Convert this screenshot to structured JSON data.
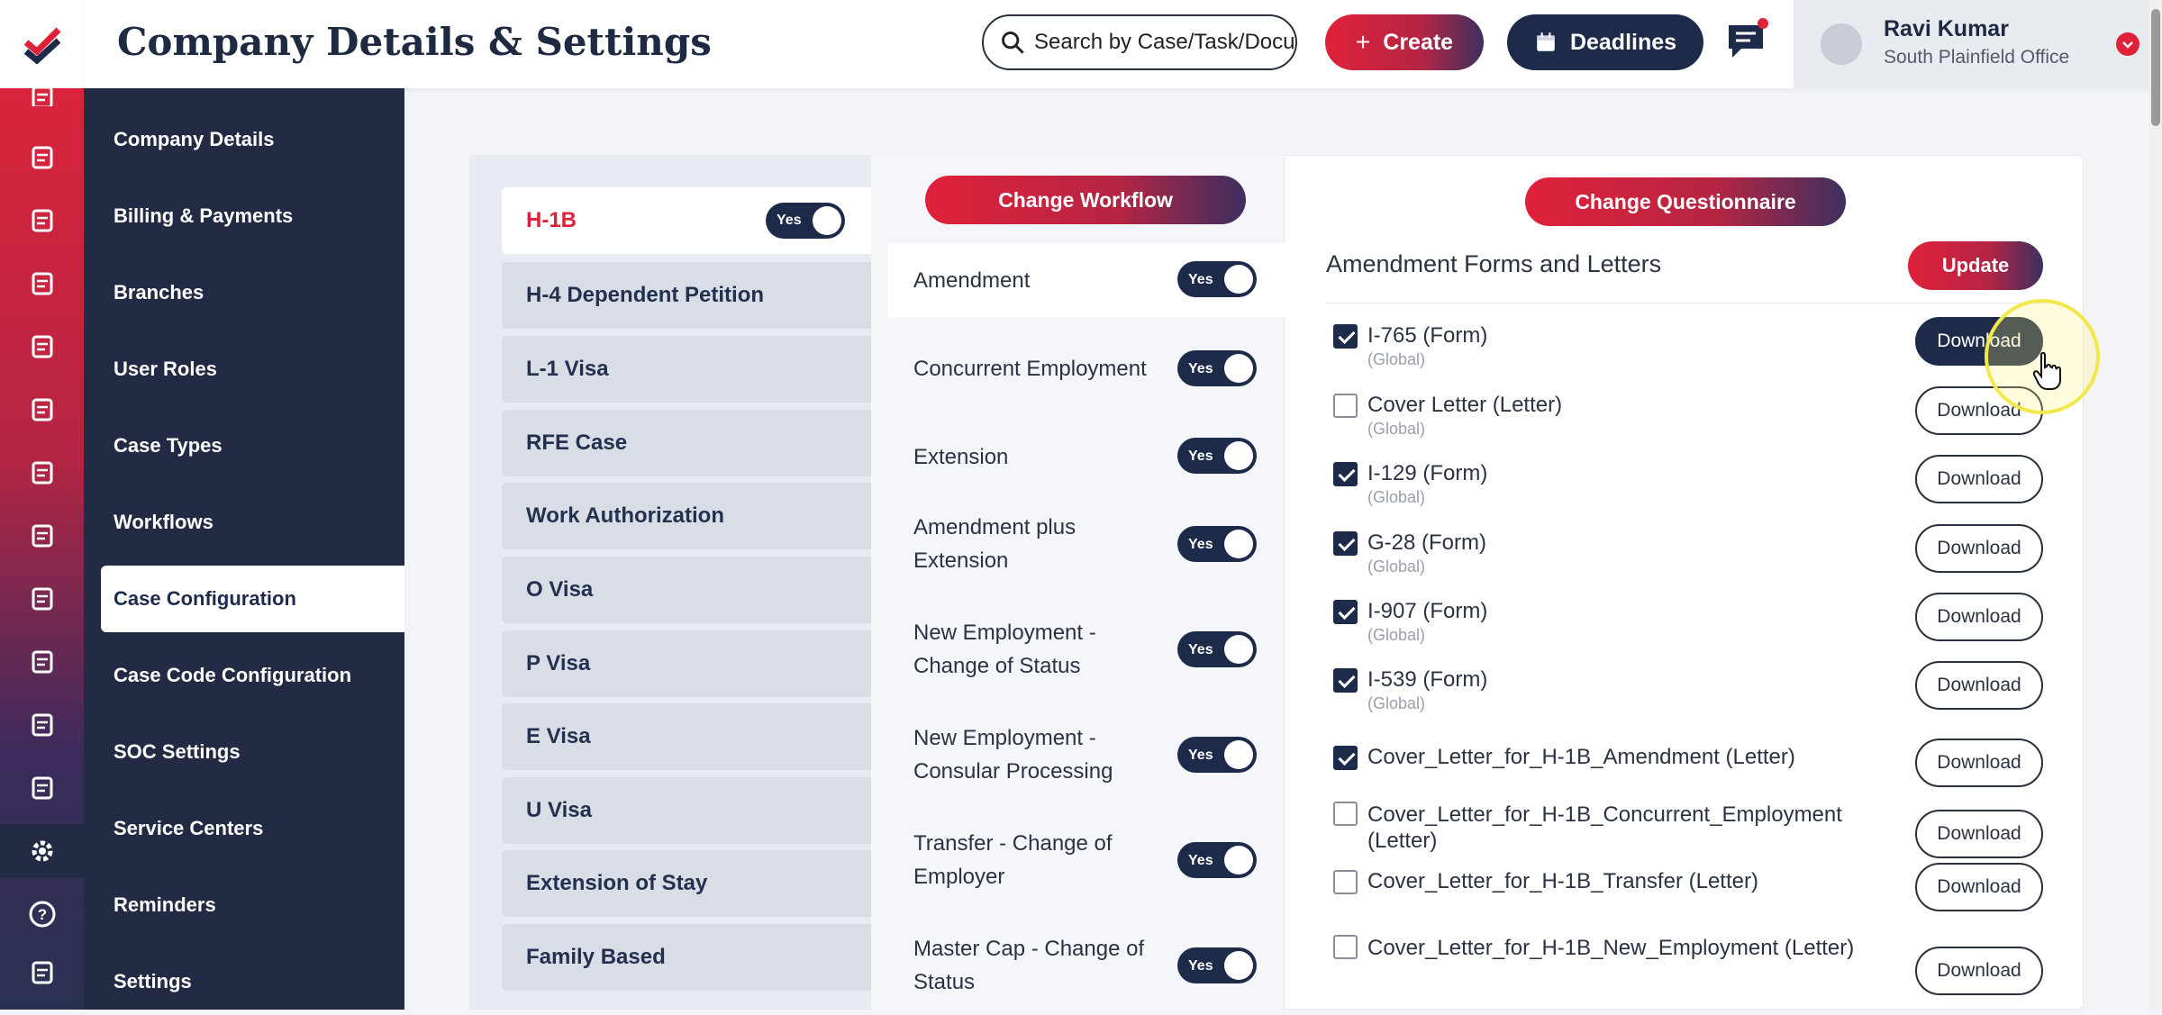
{
  "header": {
    "title": "Company Details & Settings",
    "search_placeholder": "Search by Case/Task/Document",
    "create_label": "Create",
    "deadlines_label": "Deadlines",
    "user_name": "Ravi Kumar",
    "user_office": "South Plainfield Office"
  },
  "rail_icons": [
    "edit-icon",
    "document-check-icon",
    "clipboard-icon",
    "user-icon",
    "person-icon",
    "folder-icon",
    "note-icon",
    "contact-icon",
    "book-icon",
    "team-icon",
    "file-edit-icon",
    "calendar-icon",
    "gear-icon",
    "help-icon",
    "profile-card-icon"
  ],
  "sidebar": {
    "items": [
      {
        "label": "Company Details"
      },
      {
        "label": "Billing & Payments"
      },
      {
        "label": "Branches"
      },
      {
        "label": "User Roles"
      },
      {
        "label": "Case Types"
      },
      {
        "label": "Workflows"
      },
      {
        "label": "Case Configuration"
      },
      {
        "label": "Case Code Configuration"
      },
      {
        "label": "SOC Settings"
      },
      {
        "label": "Service Centers"
      },
      {
        "label": "Reminders"
      },
      {
        "label": "Settings"
      }
    ],
    "active_index": 6
  },
  "case_types": {
    "items": [
      {
        "label": "H-1B"
      },
      {
        "label": "H-4 Dependent Petition"
      },
      {
        "label": "L-1 Visa"
      },
      {
        "label": "RFE Case"
      },
      {
        "label": "Work Authorization"
      },
      {
        "label": "O Visa"
      },
      {
        "label": "P Visa"
      },
      {
        "label": "E Visa"
      },
      {
        "label": "U Visa"
      },
      {
        "label": "Extension of Stay"
      },
      {
        "label": "Family Based"
      }
    ],
    "active_toggle": "Yes"
  },
  "workflows": {
    "change_label": "Change Workflow",
    "items": [
      {
        "label": "Amendment",
        "toggle": "Yes"
      },
      {
        "label": "Concurrent Employment",
        "toggle": "Yes"
      },
      {
        "label": "Extension",
        "toggle": "Yes"
      },
      {
        "label": "Amendment plus Extension",
        "toggle": "Yes"
      },
      {
        "label": "New Employment - Change of Status",
        "toggle": "Yes"
      },
      {
        "label": "New Employment - Consular Processing",
        "toggle": "Yes"
      },
      {
        "label": "Transfer - Change of Employer",
        "toggle": "Yes"
      },
      {
        "label": "Master Cap - Change of Status",
        "toggle": "Yes"
      }
    ]
  },
  "forms": {
    "change_questionnaire_label": "Change Questionnaire",
    "heading": "Amendment Forms and Letters",
    "update_label": "Update",
    "download_label": "Download",
    "items": [
      {
        "name": "I-765 (Form)",
        "scope": "(Global)",
        "checked": true
      },
      {
        "name": "Cover Letter (Letter)",
        "scope": "(Global)",
        "checked": false
      },
      {
        "name": "I-129 (Form)",
        "scope": "(Global)",
        "checked": true
      },
      {
        "name": "G-28 (Form)",
        "scope": "(Global)",
        "checked": true
      },
      {
        "name": "I-907 (Form)",
        "scope": "(Global)",
        "checked": true
      },
      {
        "name": "I-539 (Form)",
        "scope": "(Global)",
        "checked": true
      },
      {
        "name": "Cover_Letter_for_H-1B_Amendment (Letter)",
        "scope": "",
        "checked": true
      },
      {
        "name": "Cover_Letter_for_H-1B_Concurrent_Employment (Letter)",
        "scope": "",
        "checked": false
      },
      {
        "name": "Cover_Letter_for_H-1B_Transfer (Letter)",
        "scope": "",
        "checked": false
      },
      {
        "name": "Cover_Letter_for_H-1B_New_Employment (Letter)",
        "scope": "",
        "checked": false
      }
    ]
  },
  "colors": {
    "brand_red": "#e0213a",
    "navy": "#1e2a4a",
    "sidebar": "#232b44"
  }
}
